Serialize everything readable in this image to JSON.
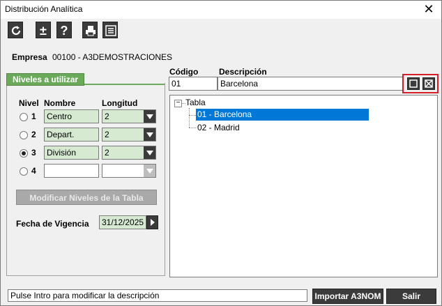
{
  "window": {
    "title": "Distribución Analítica",
    "close_glyph": "✕"
  },
  "toolbar": {
    "buttons": [
      {
        "icon": "refresh-icon"
      },
      {
        "label": "±",
        "icon": "plus-minus-icon"
      },
      {
        "label": "?",
        "icon": "help-icon"
      },
      {
        "icon": "print-icon"
      },
      {
        "icon": "list-icon"
      }
    ]
  },
  "empresa": {
    "label": "Empresa",
    "value": "00100 - A3DEMOSTRACIONES"
  },
  "niveles": {
    "group_title": "Niveles a utilizar",
    "headers": {
      "nivel": "Nivel",
      "nombre": "Nombre",
      "longitud": "Longitud"
    },
    "rows": [
      {
        "nivel": "1",
        "nombre": "Centro",
        "longitud": "2",
        "selected": false
      },
      {
        "nivel": "2",
        "nombre": "Depart.",
        "longitud": "2",
        "selected": false
      },
      {
        "nivel": "3",
        "nombre": "División",
        "longitud": "2",
        "selected": true
      },
      {
        "nivel": "4",
        "nombre": "",
        "longitud": "",
        "selected": false
      }
    ],
    "modify_button": "Modificar Niveles de la Tabla"
  },
  "fecha": {
    "label": "Fecha de Vigencia",
    "value": "31/12/2025"
  },
  "codigo": {
    "label": "Código",
    "value": "01"
  },
  "descripcion": {
    "label": "Descripción",
    "value": "Barcelona"
  },
  "tree": {
    "root": "Tabla",
    "expander": "−",
    "items": [
      {
        "label": "01 - Barcelona",
        "selected": true
      },
      {
        "label": "02 - Madrid",
        "selected": false
      }
    ]
  },
  "status": {
    "text": "Pulse Intro para modificar la descripción"
  },
  "buttons": {
    "import": "Importar A3NOM",
    "exit": "Salir"
  },
  "colors": {
    "accent_green": "#6aaa5a",
    "field_green": "#d6ead2",
    "selection": "#0078d7",
    "highlight_red": "#d21f2a"
  }
}
